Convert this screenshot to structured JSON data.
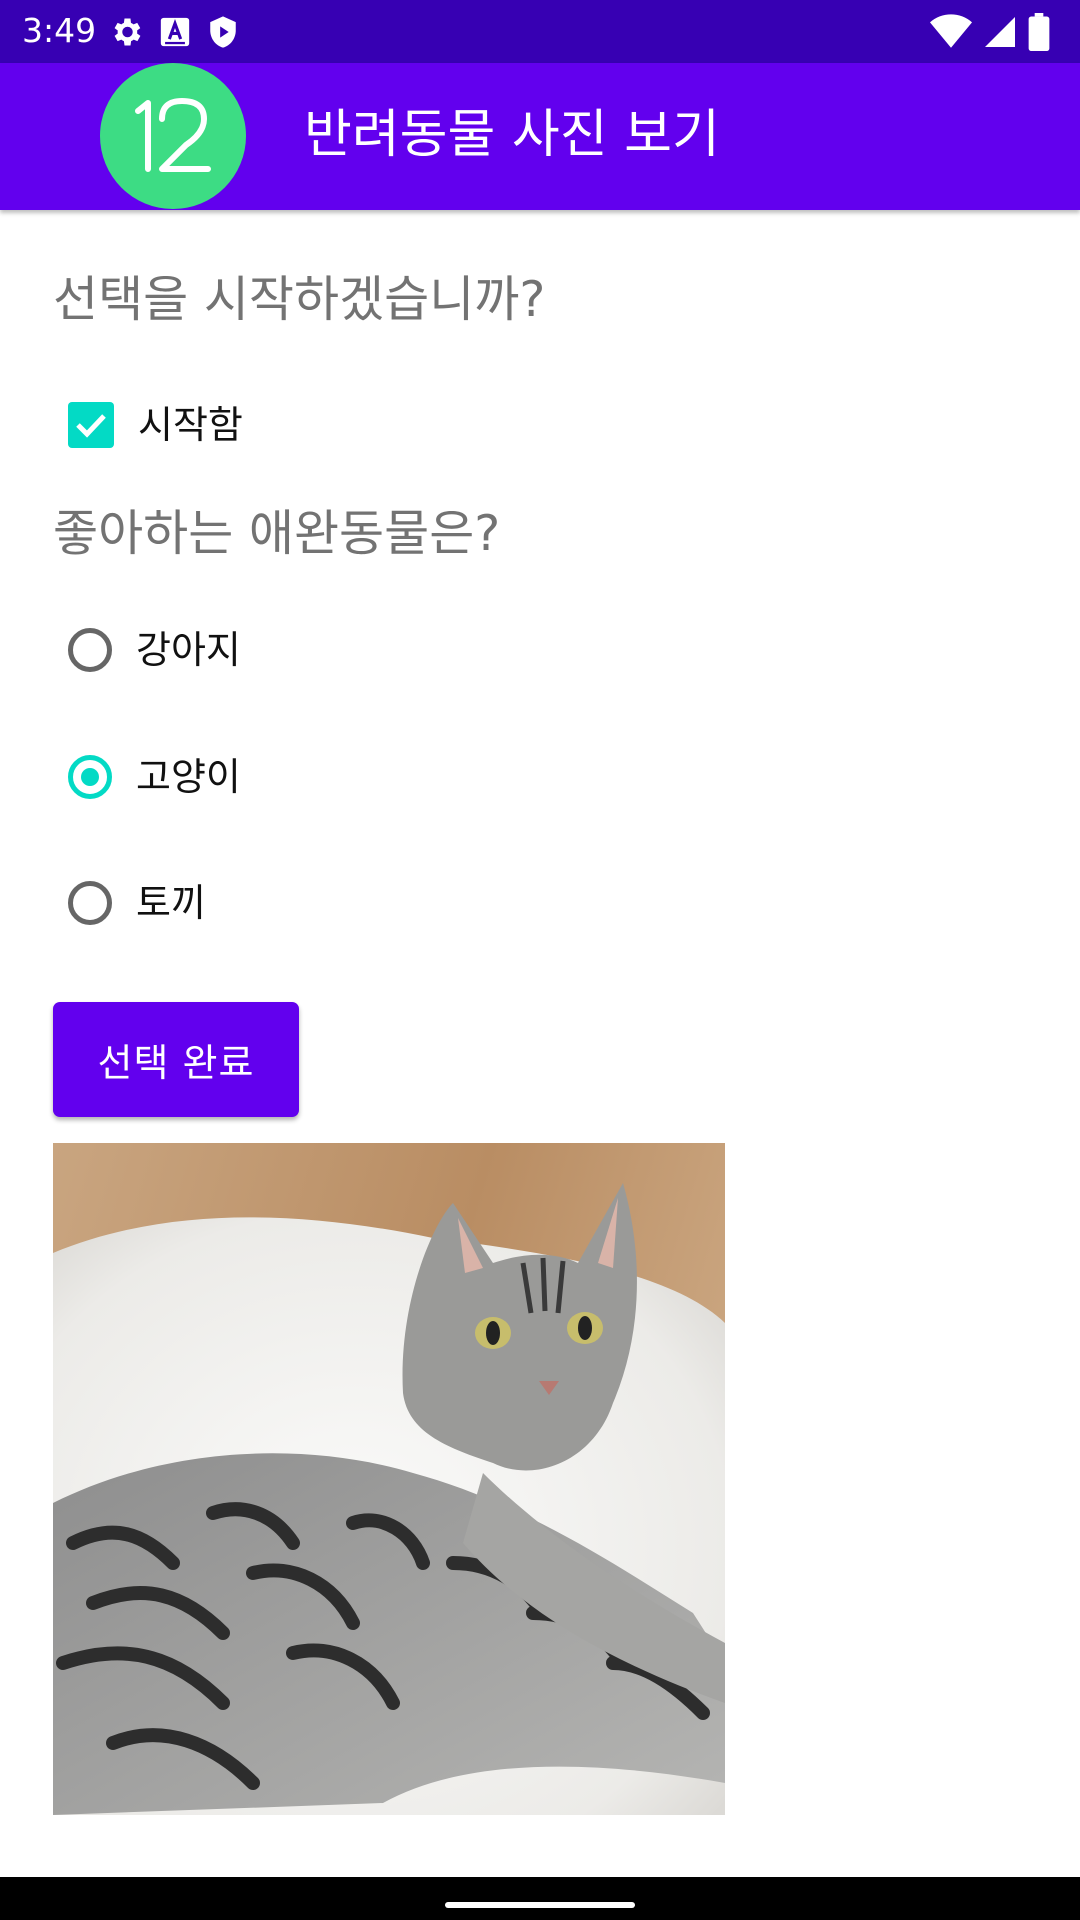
{
  "status_bar": {
    "time": "3:49",
    "left_icons": [
      "gear-icon",
      "font-a-icon",
      "shield-play-icon"
    ],
    "right_icons": [
      "wifi-icon",
      "cell-signal-icon",
      "battery-icon"
    ]
  },
  "app_bar": {
    "logo_text": "12",
    "title": "반려동물 사진 보기",
    "color": "#6200ee"
  },
  "start_question": "선택을 시작하겠습니까?",
  "start_checkbox": {
    "label": "시작함",
    "checked": true
  },
  "pet_question": "좋아하는 애완동물은?",
  "pets": [
    {
      "label": "강아지",
      "selected": false
    },
    {
      "label": "고양이",
      "selected": true
    },
    {
      "label": "토끼",
      "selected": false
    }
  ],
  "submit_label": "선택 완료",
  "photo": {
    "subject": "tabby cat lying on white fur rug"
  },
  "colors": {
    "accent": "#03dac5",
    "primary": "#6200ee",
    "status_bar": "#3700b3"
  }
}
